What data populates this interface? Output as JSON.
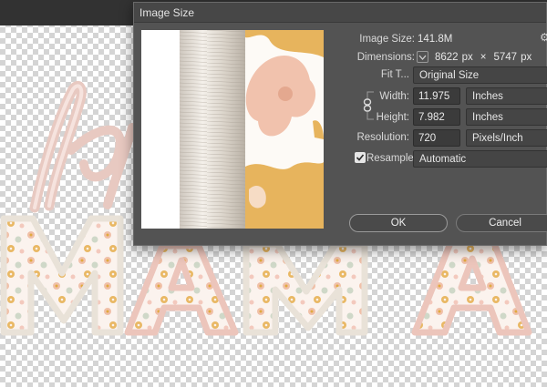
{
  "dialog": {
    "title": "Image Size",
    "image_size_label": "Image Size:",
    "image_size_value": "141.8M",
    "dimensions_label": "Dimensions:",
    "dim_width": "8622",
    "dim_unit1": "px",
    "dim_times": "×",
    "dim_height": "5747",
    "dim_unit2": "px",
    "fit_to_label": "Fit T...",
    "fit_to_value": "Original Size",
    "width_label": "Width:",
    "width_value": "11.975",
    "width_unit": "Inches",
    "height_label": "Height:",
    "height_value": "7.982",
    "height_unit": "Inches",
    "resolution_label": "Resolution:",
    "resolution_value": "720",
    "resolution_unit": "Pixels/Inch",
    "resample_label": "Resample:",
    "resample_checked": true,
    "resample_value": "Automatic",
    "ok_label": "OK",
    "cancel_label": "Cancel"
  },
  "icons": {
    "gear": "gear-icon",
    "link": "chain-link-icon",
    "chevron": "chevron-down-icon",
    "check": "checkmark-icon"
  },
  "colors": {
    "dialog_bg": "#535353",
    "title_bg": "#474747",
    "input_bg": "#3b3b3b",
    "pink": "#e9c4bb",
    "gold": "#e7b45d",
    "peach": "#f1c2ad"
  }
}
